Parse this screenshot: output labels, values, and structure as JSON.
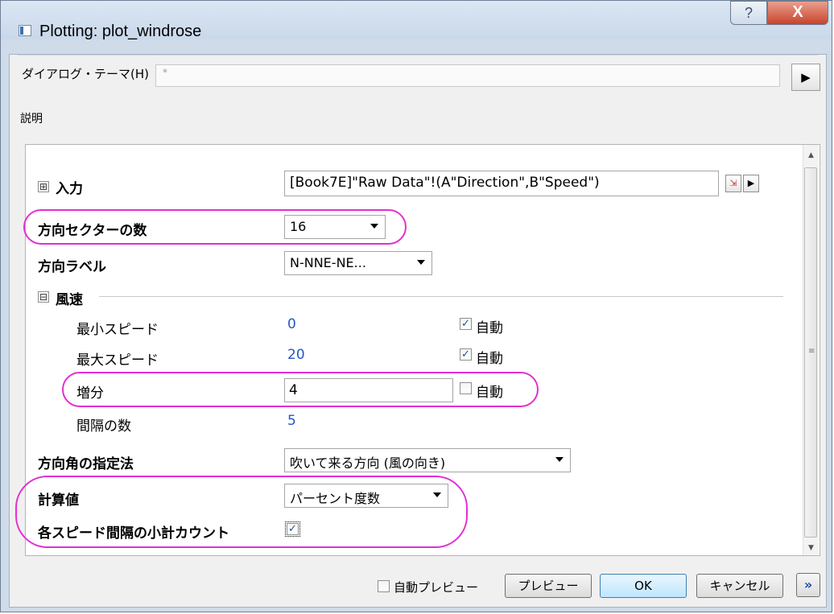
{
  "window": {
    "title": "Plotting: plot_windrose",
    "help": "?",
    "close": "X"
  },
  "theme": {
    "label": "ダイアログ・テーマ(H)",
    "value": "*",
    "arrow": "▶"
  },
  "description_label": "説明",
  "input": {
    "expand": "⊞",
    "label": "入力",
    "value": "[Book7E]\"Raw Data\"!(A\"Direction\",B\"Speed\")",
    "picker_icon": "range-picker-icon",
    "arrow": "▶"
  },
  "sectors": {
    "label": "方向セクターの数",
    "value": "16"
  },
  "direction_label": {
    "label": "方向ラベル",
    "value": "N-NNE-NE..."
  },
  "wind_speed": {
    "collapse": "⊟",
    "label": "風速",
    "min": {
      "label": "最小スピード",
      "value": "0",
      "auto_label": "自動",
      "auto_checked": true
    },
    "max": {
      "label": "最大スピード",
      "value": "20",
      "auto_label": "自動",
      "auto_checked": true
    },
    "increment": {
      "label": "増分",
      "value": "4",
      "auto_label": "自動",
      "auto_checked": false
    },
    "intervals": {
      "label": "間隔の数",
      "value": "5"
    }
  },
  "angle_spec": {
    "label": "方向角の指定法",
    "value": "吹いて来る方向 (風の向き)"
  },
  "calc_value": {
    "label": "計算値",
    "value": "パーセント度数"
  },
  "subtotal": {
    "label": "各スピード間隔の小計カウント",
    "checked": true
  },
  "footer": {
    "auto_preview": "自動プレビュー",
    "auto_preview_checked": false,
    "preview": "プレビュー",
    "ok": "OK",
    "cancel": "キャンセル",
    "more": "»"
  },
  "colors": {
    "highlight": "#e22fd2",
    "value_blue": "#2556c5",
    "title_bar": "#c9d8ea"
  }
}
